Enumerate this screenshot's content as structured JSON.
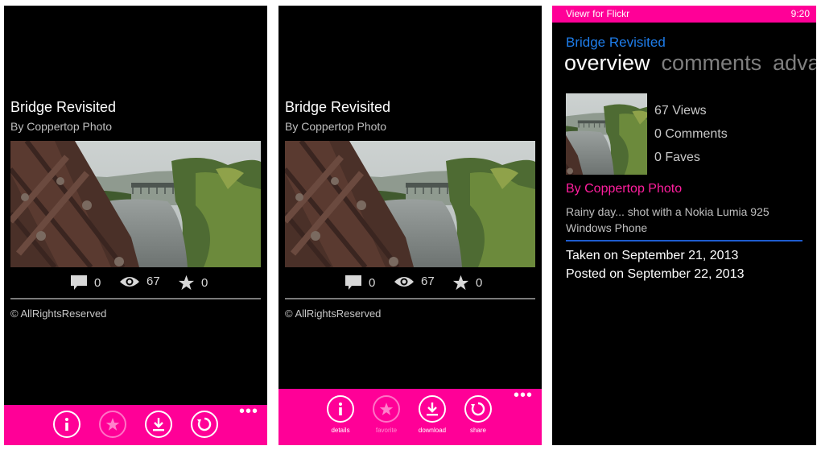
{
  "screens": [
    {
      "photo": {
        "title": "Bridge Revisited",
        "author": "By Coppertop Photo",
        "image": "landscape-photo-bridge-river"
      },
      "stats": {
        "comments": "0",
        "views": "67",
        "faves": "0"
      },
      "copyright": "© AllRightsReserved",
      "appbar": {
        "expanded": false,
        "buttons": [
          {
            "icon": "info-icon",
            "label": "details",
            "enabled": true
          },
          {
            "icon": "star-icon",
            "label": "favorite",
            "enabled": false
          },
          {
            "icon": "download-icon",
            "label": "download",
            "enabled": true
          },
          {
            "icon": "share-icon",
            "label": "share",
            "enabled": true
          }
        ],
        "more": "•••"
      }
    },
    {
      "photo": {
        "title": "Bridge Revisited",
        "author": "By Coppertop Photo",
        "image": "landscape-photo-bridge-river"
      },
      "stats": {
        "comments": "0",
        "views": "67",
        "faves": "0"
      },
      "copyright": "© AllRightsReserved",
      "appbar": {
        "expanded": true,
        "buttons": [
          {
            "icon": "info-icon",
            "label": "details",
            "enabled": true
          },
          {
            "icon": "star-icon",
            "label": "favorite",
            "enabled": false
          },
          {
            "icon": "download-icon",
            "label": "download",
            "enabled": true
          },
          {
            "icon": "share-icon",
            "label": "share",
            "enabled": true
          }
        ],
        "more": "•••"
      }
    }
  ],
  "details": {
    "status": {
      "app_name": "Viewr for Flickr",
      "time": "9:20"
    },
    "title": "Bridge Revisited",
    "pivot": [
      "overview",
      "comments",
      "adva"
    ],
    "meta": {
      "views": "67 Views",
      "comments": "0 Comments",
      "faves": "0 Faves"
    },
    "author": "By Coppertop Photo",
    "description": [
      "Rainy day... shot with a Nokia Lumia 925",
      "Windows Phone"
    ],
    "taken": "Taken on September 21, 2013",
    "posted": "Posted on September 22, 2013"
  },
  "colors": {
    "accent": "#ff0097",
    "link": "#1e7dea",
    "divider": "#1e5ccf",
    "background": "#000000"
  }
}
